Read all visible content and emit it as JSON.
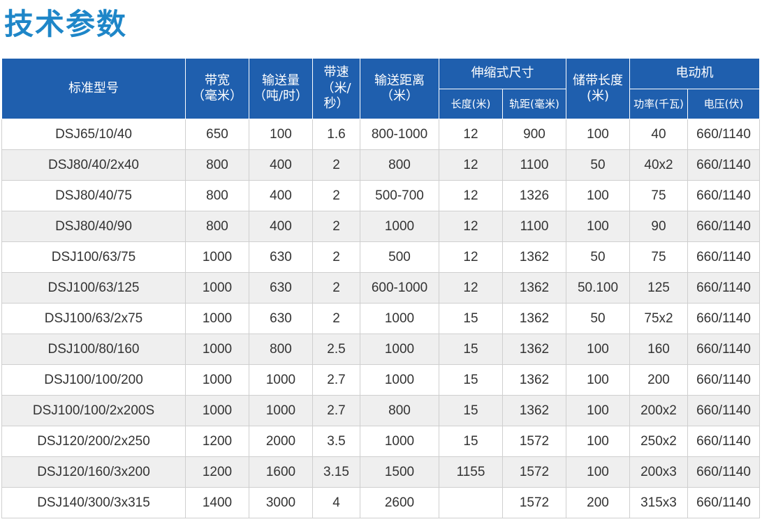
{
  "title": "技术参数",
  "headers": {
    "model": "标准型号",
    "width_l1": "带宽",
    "width_l2": "（毫米）",
    "capacity_l1": "输送量",
    "capacity_l2": "（吨/时）",
    "speed_l1": "带速",
    "speed_l2": "（米/秒）",
    "distance_l1": "输送距离",
    "distance_l2": "（米）",
    "telescopic": "伸缩式尺寸",
    "length": "长度(米)",
    "gauge": "轨距(毫米)",
    "storage_l1": "储带长度",
    "storage_l2": "(米)",
    "motor": "电动机",
    "power": "功率(千瓦)",
    "voltage": "电压(伏)"
  },
  "rows": [
    [
      "DSJ65/10/40",
      "650",
      "100",
      "1.6",
      "800-1000",
      "12",
      "900",
      "100",
      "40",
      "660/1140"
    ],
    [
      "DSJ80/40/2x40",
      "800",
      "400",
      "2",
      "800",
      "12",
      "1100",
      "50",
      "40x2",
      "660/1140"
    ],
    [
      "DSJ80/40/75",
      "800",
      "400",
      "2",
      "500-700",
      "12",
      "1326",
      "100",
      "75",
      "660/1140"
    ],
    [
      "DSJ80/40/90",
      "800",
      "400",
      "2",
      "1000",
      "12",
      "1100",
      "100",
      "90",
      "660/1140"
    ],
    [
      "DSJ100/63/75",
      "1000",
      "630",
      "2",
      "500",
      "12",
      "1362",
      "50",
      "75",
      "660/1140"
    ],
    [
      "DSJ100/63/125",
      "1000",
      "630",
      "2",
      "600-1000",
      "12",
      "1362",
      "50.100",
      "125",
      "660/1140"
    ],
    [
      "DSJ100/63/2x75",
      "1000",
      "630",
      "2",
      "1000",
      "15",
      "1362",
      "50",
      "75x2",
      "660/1140"
    ],
    [
      "DSJ100/80/160",
      "1000",
      "800",
      "2.5",
      "1000",
      "15",
      "1362",
      "100",
      "160",
      "660/1140"
    ],
    [
      "DSJ100/100/200",
      "1000",
      "1000",
      "2.7",
      "1000",
      "15",
      "1362",
      "100",
      "200",
      "660/1140"
    ],
    [
      "DSJ100/100/2x200S",
      "1000",
      "1000",
      "2.7",
      "800",
      "15",
      "1362",
      "100",
      "200x2",
      "660/1140"
    ],
    [
      "DSJ120/200/2x250",
      "1200",
      "2000",
      "3.5",
      "1000",
      "15",
      "1572",
      "100",
      "250x2",
      "660/1140"
    ],
    [
      "DSJ120/160/3x200",
      "1200",
      "1600",
      "3.15",
      "1500",
      "1155",
      "1572",
      "100",
      "200x3",
      "660/1140"
    ],
    [
      "DSJ140/300/3x315",
      "1400",
      "3000",
      "4",
      "2600",
      "",
      "1572",
      "200",
      "315x3",
      "660/1140"
    ]
  ]
}
